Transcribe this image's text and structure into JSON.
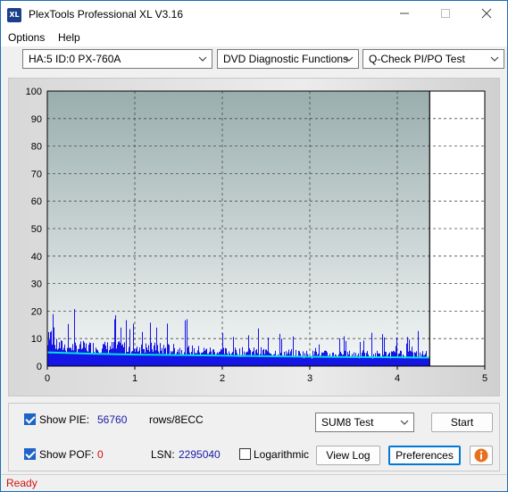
{
  "window": {
    "title": "PlexTools Professional XL V3.16",
    "icon_label": "XL"
  },
  "menu": {
    "items": [
      "Options",
      "Help"
    ]
  },
  "toolbar": {
    "drive": "HA:5 ID:0  PX-760A",
    "function": "DVD Diagnostic Functions",
    "test": "Q-Check PI/PO Test"
  },
  "chart_data": {
    "type": "area",
    "x_ticks": [
      "0",
      "1",
      "2",
      "3",
      "4",
      "5"
    ],
    "y_ticks": [
      "0",
      "10",
      "20",
      "30",
      "40",
      "50",
      "60",
      "70",
      "80",
      "90",
      "100"
    ],
    "xlim": [
      0,
      5
    ],
    "ylim": [
      0,
      100
    ],
    "grid": true,
    "data_end_x": 4.37,
    "series": [
      {
        "color": "#1515e6",
        "x": [
          0,
          0.3,
          0.6,
          1.0,
          1.5,
          2.0,
          2.5,
          3.0,
          3.5,
          4.0,
          4.37
        ],
        "values": [
          9,
          8,
          8,
          8,
          7,
          6,
          6,
          5,
          5,
          5,
          5
        ]
      },
      {
        "color": "#00e0e0",
        "x": [
          0,
          0.5,
          1.0,
          1.5,
          2.0,
          2.5,
          3.0,
          3.5,
          4.0,
          4.37
        ],
        "values": [
          5,
          4.5,
          4.2,
          4,
          3.8,
          3.6,
          3.4,
          3.3,
          3.2,
          3.1
        ]
      }
    ]
  },
  "controls": {
    "show_pie_label": "Show PIE:",
    "pie_value": "56760",
    "pie_unit": "rows/8ECC",
    "show_pof_label": "Show POF:",
    "pof_value": "0",
    "lsn_label": "LSN:",
    "lsn_value": "2295040",
    "logarithmic_label": "Logarithmic",
    "test_select": "SUM8 Test",
    "start_button": "Start",
    "view_log_button": "View Log",
    "preferences_button": "Preferences",
    "info_icon": "info-icon"
  },
  "status": {
    "text": "Ready"
  }
}
